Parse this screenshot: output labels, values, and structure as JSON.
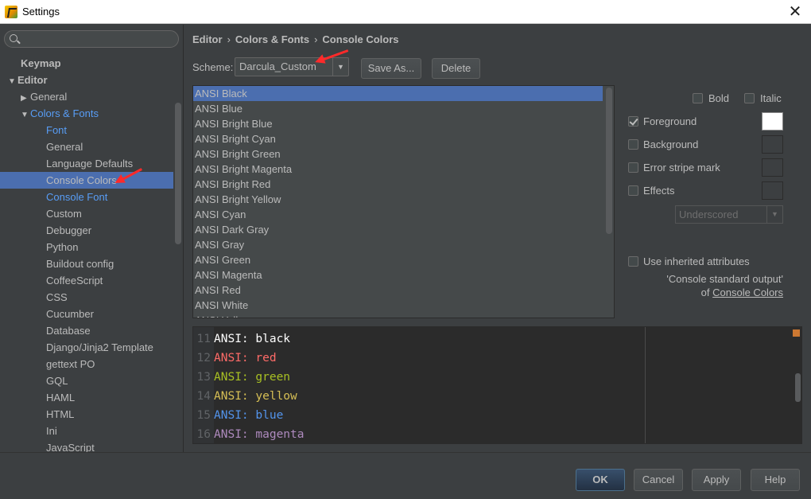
{
  "window": {
    "title": "Settings",
    "close_glyph": "✕"
  },
  "sidebar": {
    "search_placeholder": "",
    "items": [
      {
        "label": "Keymap",
        "indent": 0,
        "bold": true,
        "arrow": ""
      },
      {
        "label": "Editor",
        "indent": 0,
        "bold": true,
        "arrow": "▼"
      },
      {
        "label": "General",
        "indent": 1,
        "arrow": "▶"
      },
      {
        "label": "Colors & Fonts",
        "indent": 1,
        "arrow": "▼",
        "link": true
      },
      {
        "label": "Font",
        "indent": 2,
        "link": true
      },
      {
        "label": "General",
        "indent": 2
      },
      {
        "label": "Language Defaults",
        "indent": 2
      },
      {
        "label": "Console Colors",
        "indent": 2,
        "selected": true
      },
      {
        "label": "Console Font",
        "indent": 2,
        "link": true
      },
      {
        "label": "Custom",
        "indent": 2
      },
      {
        "label": "Debugger",
        "indent": 2
      },
      {
        "label": "Python",
        "indent": 2
      },
      {
        "label": "Buildout config",
        "indent": 2
      },
      {
        "label": "CoffeeScript",
        "indent": 2
      },
      {
        "label": "CSS",
        "indent": 2
      },
      {
        "label": "Cucumber",
        "indent": 2
      },
      {
        "label": "Database",
        "indent": 2
      },
      {
        "label": "Django/Jinja2 Template",
        "indent": 2
      },
      {
        "label": "gettext PO",
        "indent": 2
      },
      {
        "label": "GQL",
        "indent": 2
      },
      {
        "label": "HAML",
        "indent": 2
      },
      {
        "label": "HTML",
        "indent": 2
      },
      {
        "label": "Ini",
        "indent": 2
      },
      {
        "label": "JavaScript",
        "indent": 2
      }
    ]
  },
  "breadcrumb": {
    "parts": [
      "Editor",
      "Colors & Fonts",
      "Console Colors"
    ],
    "sep": "›"
  },
  "scheme": {
    "label": "Scheme:",
    "value": "Darcula_Custom",
    "save_as": "Save As...",
    "delete": "Delete"
  },
  "attributes": [
    "ANSI Black",
    "ANSI Blue",
    "ANSI Bright Blue",
    "ANSI Bright Cyan",
    "ANSI Bright Green",
    "ANSI Bright Magenta",
    "ANSI Bright Red",
    "ANSI Bright Yellow",
    "ANSI Cyan",
    "ANSI Dark Gray",
    "ANSI Gray",
    "ANSI Green",
    "ANSI Magenta",
    "ANSI Red",
    "ANSI White",
    "ANSI Yellow"
  ],
  "selected_attribute": "ANSI Black",
  "options": {
    "bold": {
      "label": "Bold",
      "checked": false
    },
    "italic": {
      "label": "Italic",
      "checked": false
    },
    "foreground": {
      "label": "Foreground",
      "checked": true,
      "color": "#ffffff"
    },
    "background": {
      "label": "Background",
      "checked": false
    },
    "error_stripe": {
      "label": "Error stripe mark",
      "checked": false
    },
    "effects": {
      "label": "Effects",
      "checked": false
    },
    "effect_type": "Underscored",
    "inherit": {
      "label": "Use inherited attributes",
      "checked": false
    },
    "inherit_note_1": "'Console standard output'",
    "inherit_note_of": "of",
    "inherit_note_link": "Console Colors"
  },
  "preview": {
    "lines": [
      {
        "num": "11",
        "prefix": "ANSI:",
        "word": "black",
        "prefix_color": "#ffffff",
        "word_color": "#ffffff"
      },
      {
        "num": "12",
        "prefix": "ANSI:",
        "word": "red",
        "prefix_color": "#ff6b68",
        "word_color": "#ff6b68"
      },
      {
        "num": "13",
        "prefix": "ANSI:",
        "word": "green",
        "prefix_color": "#a8c023",
        "word_color": "#a8c023"
      },
      {
        "num": "14",
        "prefix": "ANSI:",
        "word": "yellow",
        "prefix_color": "#d6bf55",
        "word_color": "#d6bf55"
      },
      {
        "num": "15",
        "prefix": "ANSI:",
        "word": "blue",
        "prefix_color": "#5394ec",
        "word_color": "#5394ec"
      },
      {
        "num": "16",
        "prefix": "ANSI:",
        "word": "magenta",
        "prefix_color": "#ae8abe",
        "word_color": "#ae8abe"
      }
    ]
  },
  "footer": {
    "ok": "OK",
    "cancel": "Cancel",
    "apply": "Apply",
    "help": "Help"
  },
  "colors": {
    "selection": "#4b6eaf",
    "link": "#589df6",
    "annotation": "#ff2a2a"
  }
}
